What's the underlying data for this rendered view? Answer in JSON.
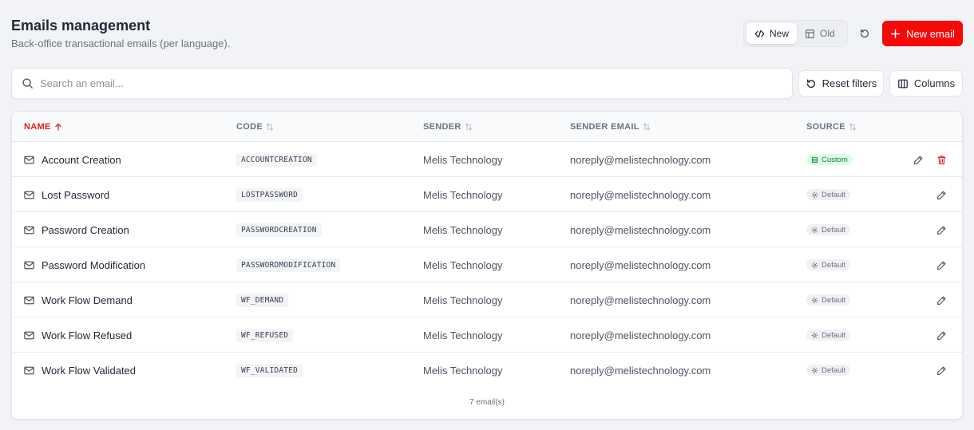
{
  "header": {
    "title": "Emails management",
    "subtitle": "Back-office transactional emails (per language)."
  },
  "view_toggle": {
    "new_label": "New",
    "old_label": "Old",
    "active": "New"
  },
  "toolbar": {
    "new_email_label": "New email",
    "reset_filters_label": "Reset filters",
    "columns_label": "Columns"
  },
  "search": {
    "placeholder": "Search an email...",
    "value": ""
  },
  "table": {
    "columns": {
      "name": "NAME",
      "code": "CODE",
      "sender": "SENDER",
      "sender_email": "SENDER EMAIL",
      "source": "SOURCE"
    },
    "sorted_column": "name",
    "sort_direction": "asc",
    "rows": [
      {
        "name": "Account Creation",
        "code": "ACCOUNTCREATION",
        "sender": "Melis Technology",
        "sender_email": "noreply@melistechnology.com",
        "source": "Custom"
      },
      {
        "name": "Lost Password",
        "code": "LOSTPASSWORD",
        "sender": "Melis Technology",
        "sender_email": "noreply@melistechnology.com",
        "source": "Default"
      },
      {
        "name": "Password Creation",
        "code": "PASSWORDCREATION",
        "sender": "Melis Technology",
        "sender_email": "noreply@melistechnology.com",
        "source": "Default"
      },
      {
        "name": "Password Modification",
        "code": "PASSWORDMODIFICATION",
        "sender": "Melis Technology",
        "sender_email": "noreply@melistechnology.com",
        "source": "Default"
      },
      {
        "name": "Work Flow Demand",
        "code": "WF_DEMAND",
        "sender": "Melis Technology",
        "sender_email": "noreply@melistechnology.com",
        "source": "Default"
      },
      {
        "name": "Work Flow Refused",
        "code": "WF_REFUSED",
        "sender": "Melis Technology",
        "sender_email": "noreply@melistechnology.com",
        "source": "Default"
      },
      {
        "name": "Work Flow Validated",
        "code": "WF_VALIDATED",
        "sender": "Melis Technology",
        "sender_email": "noreply@melistechnology.com",
        "source": "Default"
      }
    ],
    "footer_count": "7 email(s)"
  },
  "icons": {
    "row": "mail-icon",
    "edit": "pencil-icon",
    "delete": "trash-icon",
    "custom_badge": "database-icon",
    "default_badge": "gear-icon"
  },
  "colors": {
    "accent": "#f50a0a",
    "custom_badge_bg": "#dcfce7",
    "custom_badge_text": "#15803d",
    "default_badge_bg": "#f0f1f4",
    "delete_icon": "#e11d1d"
  }
}
